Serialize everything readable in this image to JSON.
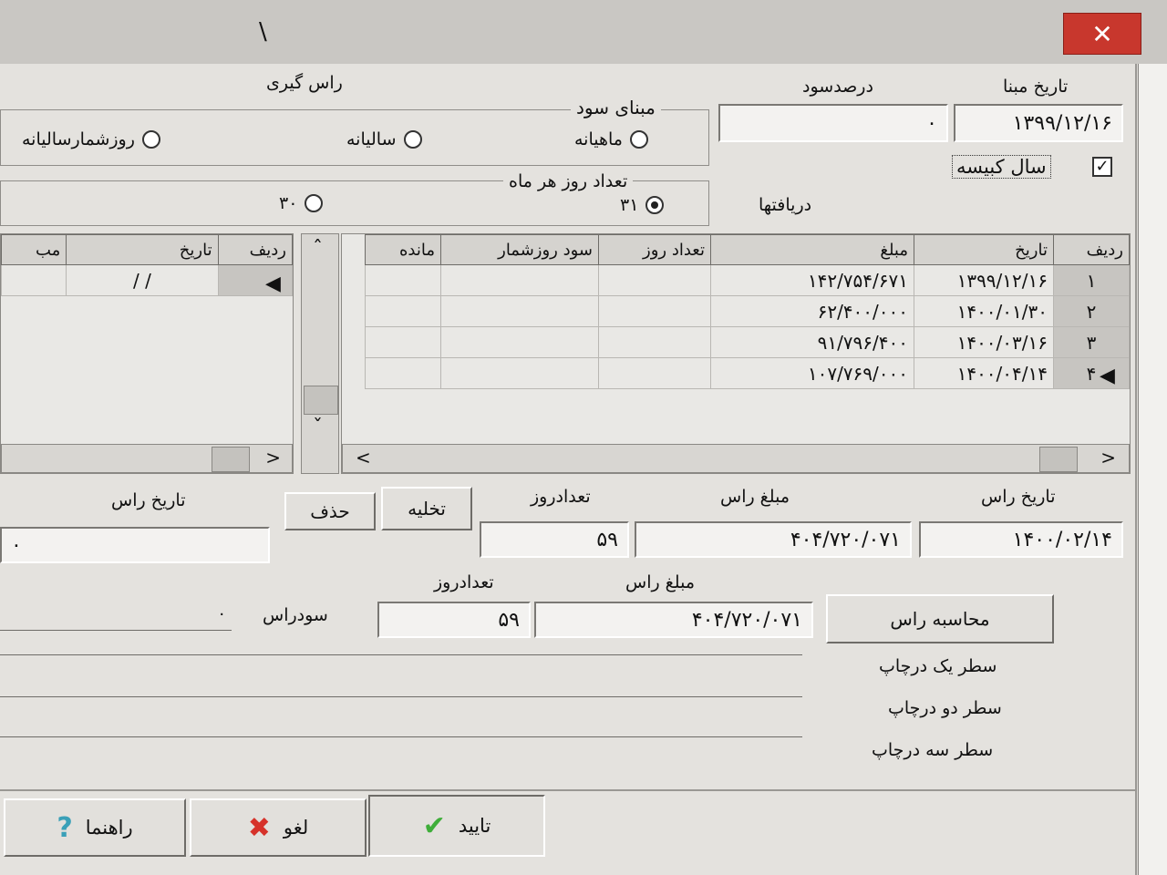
{
  "window": {
    "title_mark": "\\",
    "close_glyph": "✕"
  },
  "header": {
    "base_date_label": "تاریخ مبنا",
    "base_date_value": "۱۳۹۹/۱۲/۱۶",
    "interest_percent_label": "درصدسود",
    "interest_percent_value": "۰",
    "leap_year_label": "سال کبیسه",
    "leap_year_checked": true,
    "averaging_label": "راس گیری",
    "receipts_label": "دریافتها"
  },
  "profit_basis": {
    "label": "مبنای سود",
    "options": [
      "ماهیانه",
      "سالیانه",
      "روزشمارسالیانه"
    ],
    "selected": "ماهیانه"
  },
  "days_per_month": {
    "label": "تعداد روز هر ماه",
    "options": [
      "۳۱",
      "۳۰"
    ],
    "selected": "۳۱"
  },
  "main_grid": {
    "columns": [
      "ردیف",
      "تاریخ",
      "مبلغ",
      "تعداد روز",
      "سود روزشمار",
      "مانده"
    ],
    "rows": [
      {
        "row": "۱",
        "date": "۱۳۹۹/۱۲/۱۶",
        "amount": "۱۴۲/۷۵۴/۶۷۱",
        "days": "",
        "profit": "",
        "balance": ""
      },
      {
        "row": "۲",
        "date": "۱۴۰۰/۰۱/۳۰",
        "amount": "۶۲/۴۰۰/۰۰۰",
        "days": "",
        "profit": "",
        "balance": ""
      },
      {
        "row": "۳",
        "date": "۱۴۰۰/۰۳/۱۶",
        "amount": "۹۱/۷۹۶/۴۰۰",
        "days": "",
        "profit": "",
        "balance": ""
      },
      {
        "row": "۴",
        "date": "۱۴۰۰/۰۴/۱۴",
        "amount": "۱۰۷/۷۶۹/۰۰۰",
        "days": "",
        "profit": "",
        "balance": ""
      }
    ],
    "current_row_marker": "◀"
  },
  "side_grid": {
    "columns": [
      "ردیف",
      "تاریخ",
      "مب"
    ],
    "rows": [
      {
        "row": "",
        "date": "/ /"
      }
    ]
  },
  "scroll": {
    "up": "ˆ",
    "down": "ˇ",
    "left": "<",
    "right": ">"
  },
  "averaging": {
    "head_date_label": "تاریخ راس",
    "head_date_value": "۱۴۰۰/۰۲/۱۴",
    "head_amount_label": "مبلغ راس",
    "head_amount_value": "۴۰۴/۷۲۰/۰۷۱",
    "day_count_label": "تعدادروز",
    "day_count_value": "۵۹",
    "clear_button": "تخلیه",
    "delete_button": "حذف",
    "head_date_label_2": "تاریخ راس",
    "head_date_value_2": "۰"
  },
  "calculation": {
    "head_amount_label": "مبلغ راس",
    "head_amount_value": "۴۰۴/۷۲۰/۰۷۱",
    "day_count_label": "تعدادروز",
    "day_count_value": "۵۹",
    "head_profit_label": "سودراس",
    "head_profit_value": "۰",
    "calculate_button": "محاسبه راس"
  },
  "print_lines": {
    "line1_label": "سطر یک درچاپ",
    "line2_label": "سطر دو درچاپ",
    "line3_label": "سطر سه درچاپ"
  },
  "footer": {
    "confirm_label": "تایید",
    "cancel_label": "لغو",
    "help_label": "راهنما"
  },
  "colors": {
    "confirm_icon": "#3fae3a",
    "cancel_icon": "#d6322a",
    "help_icon": "#3aa0b8",
    "close": "#c8372d"
  }
}
